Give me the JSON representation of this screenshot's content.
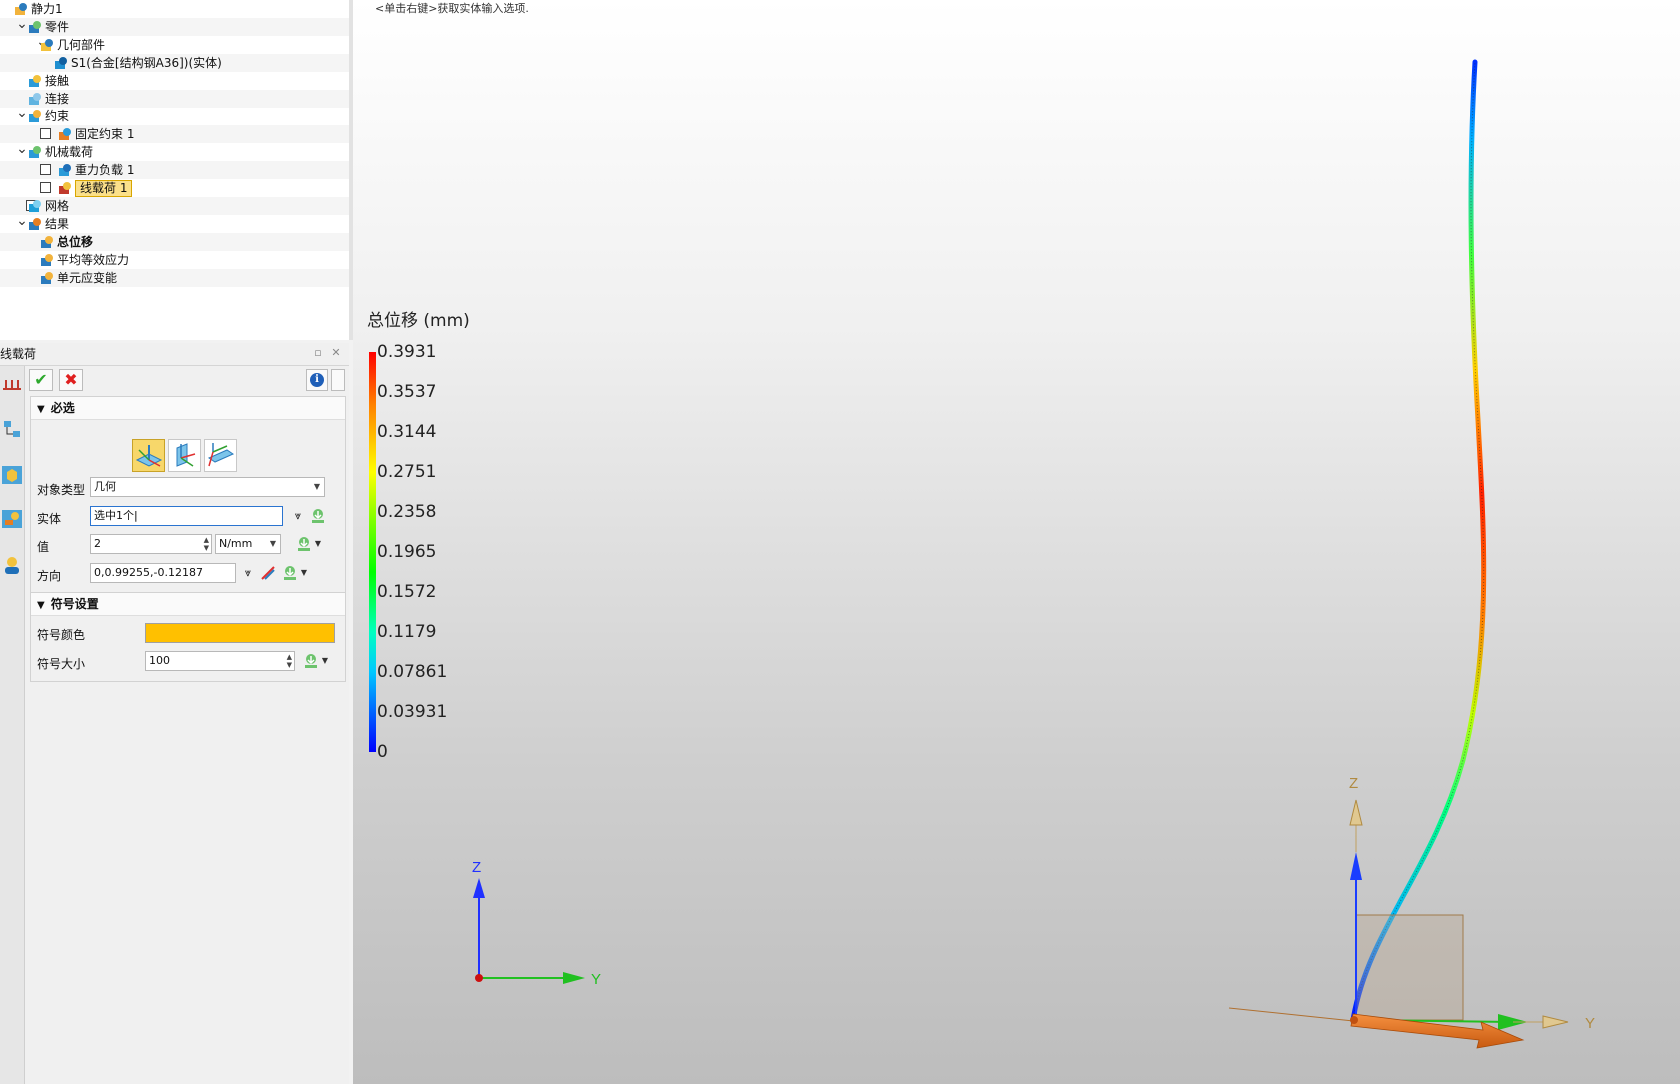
{
  "tree": {
    "items": [
      {
        "label": "静力1",
        "indent": 0,
        "expand": "",
        "check": false,
        "icon": "static-analysis-icon"
      },
      {
        "label": "零件",
        "indent": 1,
        "expand": "v",
        "check": false,
        "icon": "parts-icon"
      },
      {
        "label": "几何部件",
        "indent": 2,
        "expand": "v",
        "check": false,
        "icon": "geometry-parts-icon"
      },
      {
        "label": "S1(合金[结构钢A36])(实体)",
        "indent": 3,
        "expand": "",
        "check": false,
        "icon": "solid-body-icon"
      },
      {
        "label": "接触",
        "indent": 1,
        "expand": "",
        "check": false,
        "icon": "contact-icon"
      },
      {
        "label": "连接",
        "indent": 1,
        "expand": "",
        "check": false,
        "icon": "connection-icon"
      },
      {
        "label": "约束",
        "indent": 1,
        "expand": "v",
        "check": false,
        "icon": "constraint-icon"
      },
      {
        "label": "固定约束 1",
        "indent": 2,
        "expand": "",
        "check": true,
        "icon": "fixed-constraint-icon"
      },
      {
        "label": "机械载荷",
        "indent": 1,
        "expand": "v",
        "check": false,
        "icon": "mechanical-load-icon"
      },
      {
        "label": "重力负载 1",
        "indent": 2,
        "expand": "",
        "check": true,
        "icon": "gravity-load-icon"
      },
      {
        "label": "线载荷 1",
        "indent": 2,
        "expand": "",
        "check": true,
        "icon": "line-load-icon",
        "selected": true
      },
      {
        "label": "网格",
        "indent": 1,
        "expand": "",
        "check": true,
        "icon": "mesh-icon"
      },
      {
        "label": "结果",
        "indent": 1,
        "expand": "v",
        "check": false,
        "icon": "results-icon"
      },
      {
        "label": "总位移",
        "indent": 2,
        "expand": "",
        "check": false,
        "icon": "result-plot-icon",
        "bold": true
      },
      {
        "label": "平均等效应力",
        "indent": 2,
        "expand": "",
        "check": false,
        "icon": "result-plot-icon"
      },
      {
        "label": "单元应变能",
        "indent": 2,
        "expand": "",
        "check": false,
        "icon": "result-plot-icon"
      }
    ]
  },
  "panel": {
    "title": "线载荷",
    "required_section": "必选",
    "symbol_section": "符号设置",
    "object_type_label": "对象类型",
    "object_type_value": "几何",
    "entity_label": "实体",
    "entity_value": "选中1个",
    "value_label": "值",
    "value_value": "2",
    "unit_value": "N/mm",
    "direction_label": "方向",
    "direction_value": "0,0.99255,-0.12187",
    "symbol_color_label": "符号颜色",
    "symbol_color": "#ffc000",
    "symbol_size_label": "符号大小",
    "symbol_size_value": "100"
  },
  "viewport": {
    "hint": "<单击右键>获取实体输入选项.",
    "legend_title": "总位移 (mm)",
    "legend_values": [
      "0.3931",
      "0.3537",
      "0.3144",
      "0.2751",
      "0.2358",
      "0.1965",
      "0.1572",
      "0.1179",
      "0.07861",
      "0.03931",
      "0"
    ],
    "axis_z": "Z",
    "axis_y": "Y"
  },
  "colors": {
    "accent_selected": "#fbe08a",
    "load_arrow": "#e87020",
    "beam_gradient": [
      "#0000ff",
      "#00c8ff",
      "#00ff00",
      "#ffff00",
      "#ff0000"
    ]
  }
}
